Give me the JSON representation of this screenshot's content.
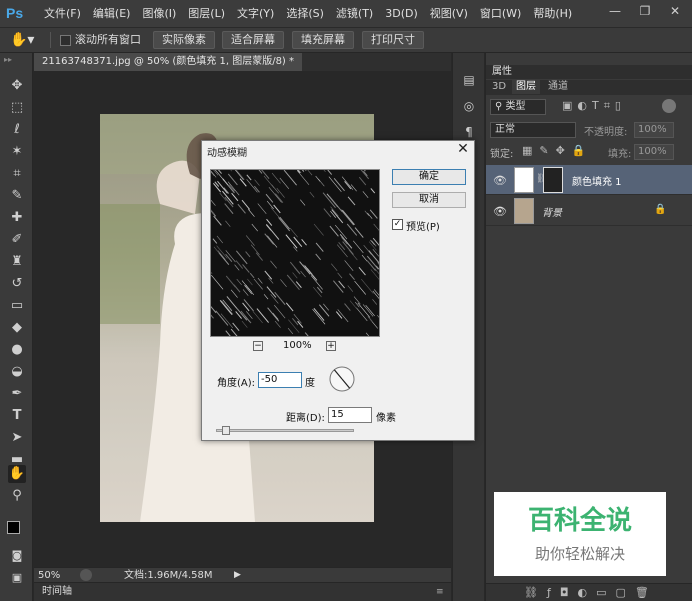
{
  "app": {
    "logo": "Ps"
  },
  "menu": [
    "文件(F)",
    "编辑(E)",
    "图像(I)",
    "图层(L)",
    "文字(Y)",
    "选择(S)",
    "滤镜(T)",
    "3D(D)",
    "视图(V)",
    "窗口(W)",
    "帮助(H)"
  ],
  "window_controls": {
    "minimize": "—",
    "restore": "❐",
    "close": "✕"
  },
  "options": {
    "scroll_all_label": "滚动所有窗口",
    "buttons": [
      "实际像素",
      "适合屏幕",
      "填充屏幕",
      "打印尺寸"
    ]
  },
  "document": {
    "tab_title": "21163748371.jpg @ 50% (颜色填充 1, 图层蒙版/8) *",
    "zoom": "50%",
    "doc_info": "文档:1.96M/4.58M",
    "timeline_label": "时间轴"
  },
  "panel": {
    "properties_tab": "属性",
    "tabs": [
      "3D",
      "图层",
      "通道"
    ],
    "filter_kind": "类型",
    "blend_mode": "正常",
    "opacity_label": "不透明度:",
    "opacity_value": "100%",
    "lock_label": "锁定:",
    "fill_label": "填充:",
    "fill_value": "100%",
    "layers": [
      {
        "name": "颜色填充 1",
        "selected": true
      },
      {
        "name": "背景",
        "selected": false
      }
    ]
  },
  "dialog": {
    "title": "动感模糊",
    "ok": "确定",
    "cancel": "取消",
    "preview_label": "预览(P)",
    "preview_checked": true,
    "zoom_minus": "−",
    "zoom_plus": "+",
    "zoom_value": "100%",
    "angle_label": "角度(A):",
    "angle_value": "-50",
    "angle_unit": "度",
    "distance_label": "距离(D):",
    "distance_value": "15",
    "distance_unit": "像素"
  },
  "watermark": {
    "title": "百科全说",
    "subtitle": "助你轻松解决"
  },
  "colors": {
    "accent": "#4aa8e8",
    "watermark_green": "#3cb371"
  }
}
